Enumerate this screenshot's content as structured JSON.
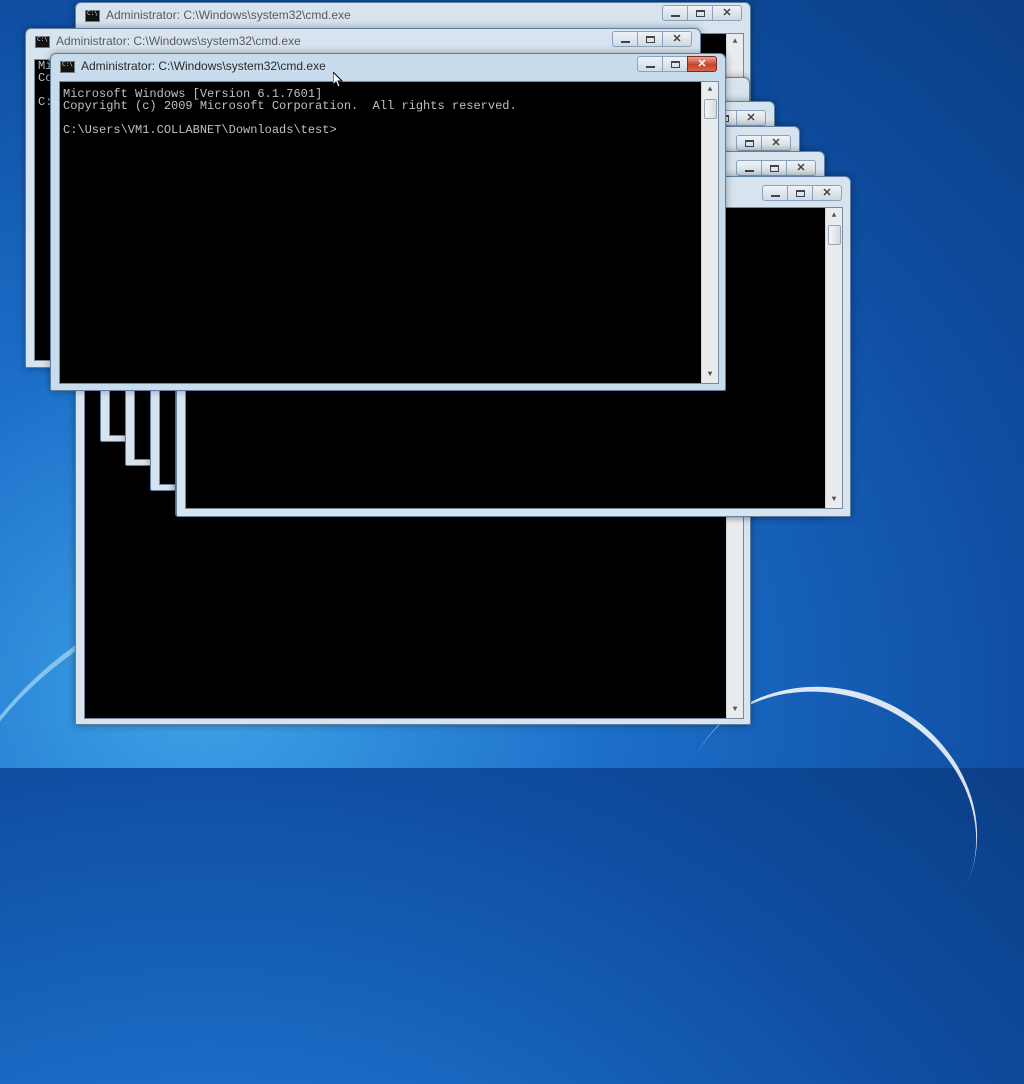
{
  "windows": [
    {
      "id": "w1",
      "title": "Administrator: C:\\Windows\\system32\\cmd.exe",
      "state": "inactive"
    },
    {
      "id": "w2",
      "title": "Administrator: C:\\Windows\\system32\\cmd.exe",
      "state": "inactive"
    },
    {
      "id": "w3",
      "title": "Administrator: C:\\Windows\\system32\\cmd.exe",
      "state": "active",
      "console_lines": [
        "Microsoft Windows [Version 6.1.7601]",
        "Copyright (c) 2009 Microsoft Corporation.  All rights reserved.",
        "",
        "C:\\Users\\VM1.COLLABNET\\Downloads\\test>"
      ]
    }
  ],
  "background_window_partial_text": [
    "Mi",
    "Co",
    "",
    "C:"
  ],
  "icons": {
    "window_icon": "cmd-icon",
    "minimize": "minimize-icon",
    "maximize": "maximize-icon",
    "close": "close-icon",
    "scroll_up": "scroll-up-arrow-icon",
    "scroll_down": "scroll-down-arrow-icon"
  },
  "colors": {
    "console_bg": "#000000",
    "console_text": "#c0c0c0",
    "close_active": "#c7442c",
    "desktop": "#1c6fc9"
  }
}
